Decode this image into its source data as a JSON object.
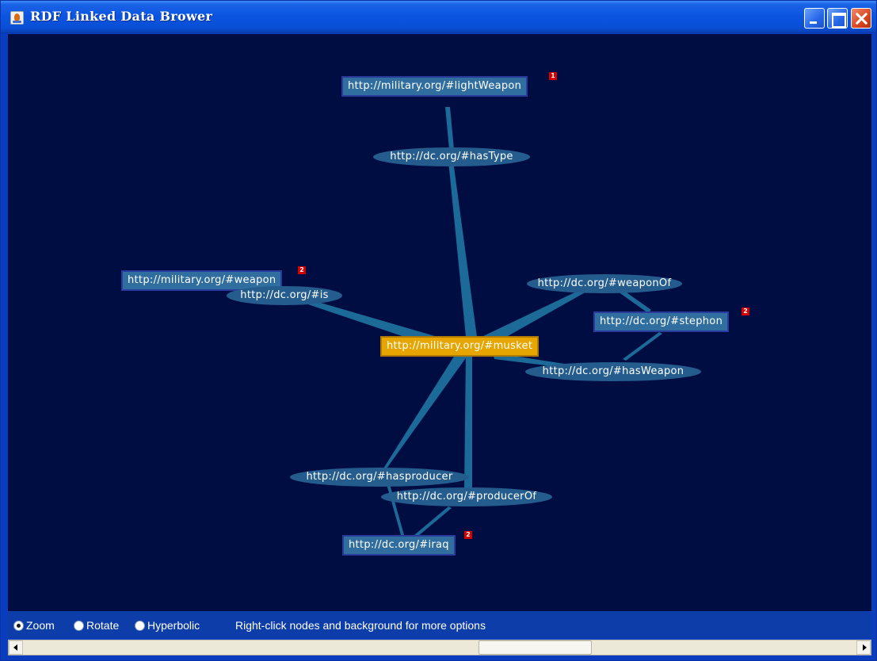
{
  "window": {
    "title": "RDF Linked Data Brower",
    "controls": [
      "minimize-icon",
      "maximize-icon",
      "close-icon"
    ]
  },
  "graph": {
    "focus_node": "http://military.org/#musket",
    "nodes": [
      {
        "id": "lightWeapon",
        "label": "http://military.org/#lightWeapon",
        "kind": "resource",
        "badge": "1"
      },
      {
        "id": "hasType",
        "label": "http://dc.org/#hasType",
        "kind": "property"
      },
      {
        "id": "weapon",
        "label": "http://military.org/#weapon",
        "kind": "resource",
        "badge": "2"
      },
      {
        "id": "is",
        "label": "http://dc.org/#is",
        "kind": "property"
      },
      {
        "id": "weaponOf",
        "label": "http://dc.org/#weaponOf",
        "kind": "property"
      },
      {
        "id": "stephon",
        "label": "http://dc.org/#stephon",
        "kind": "resource",
        "badge": "2"
      },
      {
        "id": "musket",
        "label": "http://military.org/#musket",
        "kind": "focus"
      },
      {
        "id": "hasWeapon",
        "label": "http://dc.org/#hasWeapon",
        "kind": "property"
      },
      {
        "id": "hasproducer",
        "label": "http://dc.org/#hasproducer",
        "kind": "property"
      },
      {
        "id": "producerOf",
        "label": "http://dc.org/#producerOf",
        "kind": "property"
      },
      {
        "id": "iraq",
        "label": "http://dc.org/#iraq",
        "kind": "resource",
        "badge": "2"
      }
    ],
    "edges": [
      [
        "lightWeapon",
        "hasType"
      ],
      [
        "hasType",
        "musket"
      ],
      [
        "weapon",
        "is"
      ],
      [
        "is",
        "musket"
      ],
      [
        "musket",
        "weaponOf"
      ],
      [
        "weaponOf",
        "stephon"
      ],
      [
        "stephon",
        "hasWeapon"
      ],
      [
        "hasWeapon",
        "musket"
      ],
      [
        "musket",
        "hasproducer"
      ],
      [
        "hasproducer",
        "iraq"
      ],
      [
        "iraq",
        "producerOf"
      ],
      [
        "producerOf",
        "musket"
      ]
    ]
  },
  "statusbar": {
    "modes": [
      {
        "label": "Zoom",
        "selected": true
      },
      {
        "label": "Rotate",
        "selected": false
      },
      {
        "label": "Hyperbolic",
        "selected": false
      }
    ],
    "hint": "Right-click nodes and background for more options"
  },
  "scrollbar": {
    "left_button_icon": "scroll-left-icon",
    "right_button_icon": "scroll-right-icon"
  },
  "colors": {
    "canvas_background": "#000d42",
    "edge": "#1c6a98",
    "resource_node": "#2f6e9e",
    "property_node": "#245c8e",
    "focus_node": "#e7a500",
    "badge": "#d40000"
  }
}
